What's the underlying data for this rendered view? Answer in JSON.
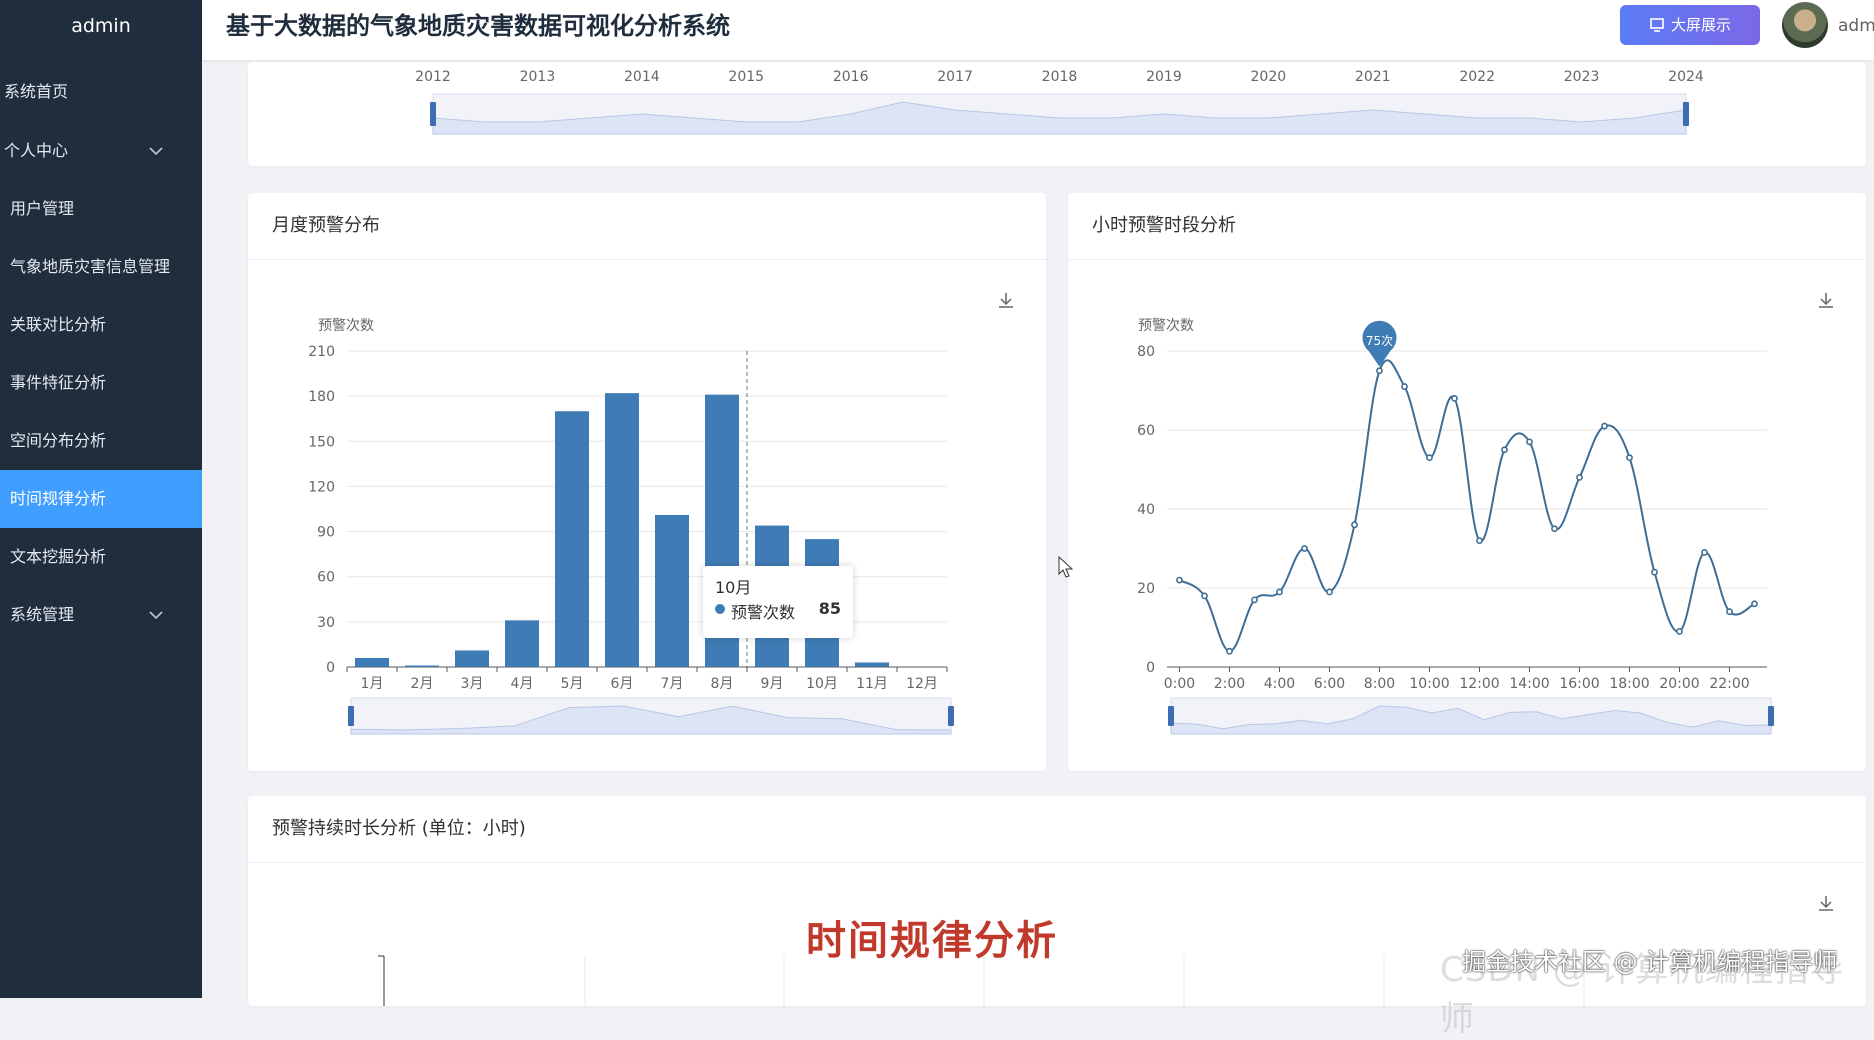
{
  "app": {
    "title": "基于大数据的气象地质灾害数据可视化分析系统",
    "big_screen_label": "大屏展示",
    "user_name": "admin"
  },
  "sidebar": {
    "logo": "admin",
    "items": [
      {
        "label": "系统首页"
      },
      {
        "label": "个人中心",
        "expandable": true
      },
      {
        "label": "用户管理"
      },
      {
        "label": "气象地质灾害信息管理"
      },
      {
        "label": "关联对比分析"
      },
      {
        "label": "事件特征分析"
      },
      {
        "label": "空间分布分析"
      },
      {
        "label": "时间规律分析",
        "active": true
      },
      {
        "label": "文本挖掘分析"
      },
      {
        "label": "系统管理",
        "expandable": true
      }
    ]
  },
  "top_chart": {
    "years": [
      "2012",
      "2013",
      "2014",
      "2015",
      "2016",
      "2017",
      "2018",
      "2019",
      "2020",
      "2021",
      "2022",
      "2023",
      "2024"
    ]
  },
  "monthly": {
    "title": "月度预警分布",
    "chart_data": {
      "type": "bar",
      "ylabel": "预警次数",
      "categories": [
        "1月",
        "2月",
        "3月",
        "4月",
        "5月",
        "6月",
        "7月",
        "8月",
        "9月",
        "10月",
        "11月",
        "12月"
      ],
      "values": [
        6,
        1,
        11,
        31,
        170,
        182,
        101,
        181,
        94,
        85,
        3,
        0
      ],
      "ylim": [
        0,
        210
      ],
      "yticks": [
        "0",
        "30",
        "60",
        "90",
        "120",
        "150",
        "180",
        "210"
      ],
      "color": "#3f7cb5"
    },
    "tooltip": {
      "title": "10月",
      "series": "预警次数",
      "value": "85"
    }
  },
  "hourly": {
    "title": "小时预警时段分析",
    "chart_data": {
      "type": "line",
      "ylabel": "预警次数",
      "x": [
        0,
        1,
        2,
        3,
        4,
        5,
        6,
        7,
        8,
        9,
        10,
        11,
        12,
        13,
        14,
        15,
        16,
        17,
        18,
        19,
        20,
        21,
        22,
        23
      ],
      "xticks": [
        "0:00",
        "2:00",
        "4:00",
        "6:00",
        "8:00",
        "10:00",
        "12:00",
        "14:00",
        "16:00",
        "18:00",
        "20:00",
        "22:00"
      ],
      "values": [
        22,
        18,
        4,
        17,
        19,
        30,
        19,
        36,
        75,
        71,
        53,
        68,
        32,
        55,
        57,
        35,
        48,
        61,
        53,
        24,
        9,
        29,
        14,
        16
      ],
      "ylim": [
        0,
        80
      ],
      "yticks": [
        "0",
        "20",
        "40",
        "60",
        "80"
      ],
      "color": "#3e6e96"
    },
    "max_label": "75次"
  },
  "duration": {
    "title": "预警持续时长分析 (单位：小时)"
  },
  "overlay": {
    "title": "时间规律分析",
    "watermark": "掘金技术社区 @ 计算机编程指导师",
    "watermark_faint": "CSDN @ 计算机编程指导师"
  }
}
